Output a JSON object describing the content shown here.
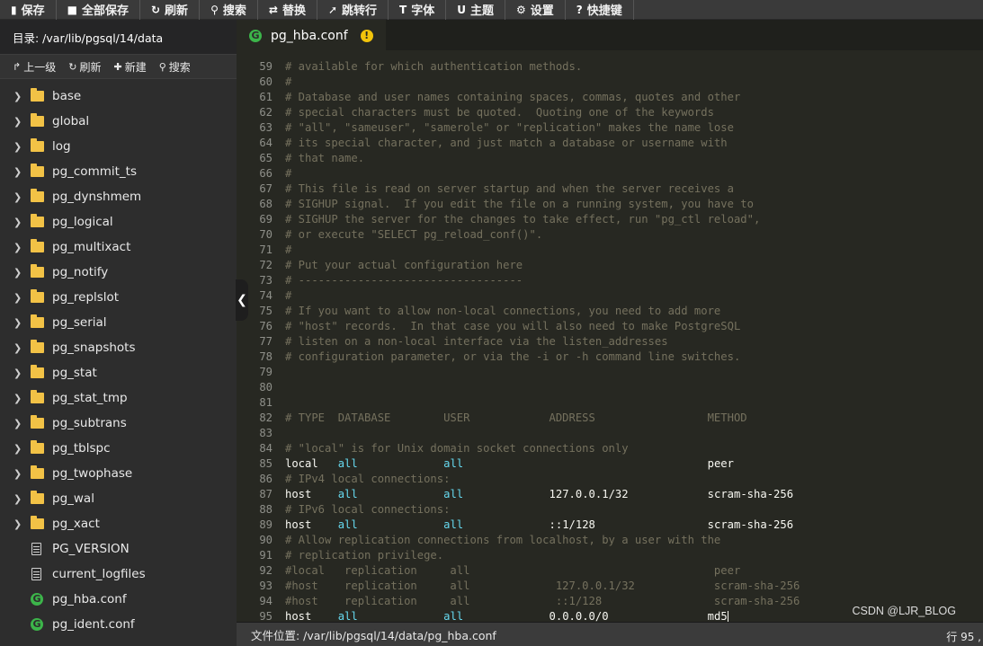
{
  "toolbar": [
    {
      "icon": "save-icon",
      "glyph": "▮",
      "label": "保存"
    },
    {
      "icon": "save-all-icon",
      "glyph": "■",
      "label": "全部保存"
    },
    {
      "icon": "refresh-icon",
      "glyph": "↻",
      "label": "刷新"
    },
    {
      "icon": "search-icon",
      "glyph": "⚲",
      "label": "搜索"
    },
    {
      "icon": "replace-icon",
      "glyph": "⇄",
      "label": "替换"
    },
    {
      "icon": "jump-icon",
      "glyph": "➚",
      "label": "跳转行"
    },
    {
      "icon": "font-icon",
      "glyph": "T",
      "label": "字体"
    },
    {
      "icon": "theme-icon",
      "glyph": "U",
      "label": "主题"
    },
    {
      "icon": "gear-icon",
      "glyph": "⚙",
      "label": "设置"
    },
    {
      "icon": "help-icon",
      "glyph": "?",
      "label": "快捷键"
    }
  ],
  "sidebar": {
    "dir_label": "目录: /var/lib/pgsql/14/data",
    "actions": [
      {
        "icon": "up-icon",
        "glyph": "↱",
        "label": "上一级"
      },
      {
        "icon": "refresh-icon",
        "glyph": "↻",
        "label": "刷新"
      },
      {
        "icon": "plus-icon",
        "glyph": "✚",
        "label": "新建"
      },
      {
        "icon": "search-icon",
        "glyph": "⚲",
        "label": "搜索"
      }
    ],
    "tree": [
      {
        "type": "folder",
        "name": "base"
      },
      {
        "type": "folder",
        "name": "global"
      },
      {
        "type": "folder",
        "name": "log"
      },
      {
        "type": "folder",
        "name": "pg_commit_ts"
      },
      {
        "type": "folder",
        "name": "pg_dynshmem"
      },
      {
        "type": "folder",
        "name": "pg_logical"
      },
      {
        "type": "folder",
        "name": "pg_multixact"
      },
      {
        "type": "folder",
        "name": "pg_notify"
      },
      {
        "type": "folder",
        "name": "pg_replslot"
      },
      {
        "type": "folder",
        "name": "pg_serial"
      },
      {
        "type": "folder",
        "name": "pg_snapshots"
      },
      {
        "type": "folder",
        "name": "pg_stat"
      },
      {
        "type": "folder",
        "name": "pg_stat_tmp"
      },
      {
        "type": "folder",
        "name": "pg_subtrans"
      },
      {
        "type": "folder",
        "name": "pg_tblspc"
      },
      {
        "type": "folder",
        "name": "pg_twophase"
      },
      {
        "type": "folder",
        "name": "pg_wal"
      },
      {
        "type": "folder",
        "name": "pg_xact"
      },
      {
        "type": "file",
        "name": "PG_VERSION"
      },
      {
        "type": "file",
        "name": "current_logfiles"
      },
      {
        "type": "conf",
        "name": "pg_hba.conf"
      },
      {
        "type": "conf",
        "name": "pg_ident.conf"
      }
    ]
  },
  "editor": {
    "tab": {
      "label": "pg_hba.conf",
      "conf_glyph": "G",
      "warn_glyph": "!"
    },
    "lines": [
      {
        "n": "59",
        "kind": "comment",
        "text": "# available for which authentication methods."
      },
      {
        "n": "60",
        "kind": "comment",
        "text": "#"
      },
      {
        "n": "61",
        "kind": "comment",
        "text": "# Database and user names containing spaces, commas, quotes and other"
      },
      {
        "n": "62",
        "kind": "comment",
        "text": "# special characters must be quoted.  Quoting one of the keywords"
      },
      {
        "n": "63",
        "kind": "comment",
        "text": "# \"all\", \"sameuser\", \"samerole\" or \"replication\" makes the name lose"
      },
      {
        "n": "64",
        "kind": "comment",
        "text": "# its special character, and just match a database or username with"
      },
      {
        "n": "65",
        "kind": "comment",
        "text": "# that name."
      },
      {
        "n": "66",
        "kind": "comment",
        "text": "#"
      },
      {
        "n": "67",
        "kind": "comment",
        "text": "# This file is read on server startup and when the server receives a"
      },
      {
        "n": "68",
        "kind": "comment",
        "text": "# SIGHUP signal.  If you edit the file on a running system, you have to"
      },
      {
        "n": "69",
        "kind": "comment",
        "text": "# SIGHUP the server for the changes to take effect, run \"pg_ctl reload\","
      },
      {
        "n": "70",
        "kind": "comment",
        "text": "# or execute \"SELECT pg_reload_conf()\"."
      },
      {
        "n": "71",
        "kind": "comment",
        "text": "#"
      },
      {
        "n": "72",
        "kind": "comment",
        "text": "# Put your actual configuration here"
      },
      {
        "n": "73",
        "kind": "comment",
        "text": "# ----------------------------------"
      },
      {
        "n": "74",
        "kind": "comment",
        "text": "#"
      },
      {
        "n": "75",
        "kind": "comment",
        "text": "# If you want to allow non-local connections, you need to add more"
      },
      {
        "n": "76",
        "kind": "comment",
        "text": "# \"host\" records.  In that case you will also need to make PostgreSQL"
      },
      {
        "n": "77",
        "kind": "comment",
        "text": "# listen on a non-local interface via the listen_addresses"
      },
      {
        "n": "78",
        "kind": "comment",
        "text": "# configuration parameter, or via the -i or -h command line switches."
      },
      {
        "n": "79",
        "kind": "comment",
        "text": ""
      },
      {
        "n": "80",
        "kind": "comment",
        "text": ""
      },
      {
        "n": "81",
        "kind": "comment",
        "text": ""
      },
      {
        "n": "82",
        "kind": "comment",
        "text": "# TYPE  DATABASE        USER            ADDRESS                 METHOD"
      },
      {
        "n": "83",
        "kind": "comment",
        "text": ""
      },
      {
        "n": "84",
        "kind": "comment",
        "text": "# \"local\" is for Unix domain socket connections only"
      },
      {
        "n": "85",
        "kind": "entry",
        "type": "local",
        "db": "all",
        "user": "all",
        "addr": "",
        "method": "peer"
      },
      {
        "n": "86",
        "kind": "comment",
        "text": "# IPv4 local connections:"
      },
      {
        "n": "87",
        "kind": "entry",
        "type": "host",
        "db": "all",
        "user": "all",
        "addr": "127.0.0.1/32",
        "method": "scram-sha-256"
      },
      {
        "n": "88",
        "kind": "comment",
        "text": "# IPv6 local connections:"
      },
      {
        "n": "89",
        "kind": "entry",
        "type": "host",
        "db": "all",
        "user": "all",
        "addr": "::1/128",
        "method": "scram-sha-256"
      },
      {
        "n": "90",
        "kind": "comment",
        "text": "# Allow replication connections from localhost, by a user with the"
      },
      {
        "n": "91",
        "kind": "comment",
        "text": "# replication privilege."
      },
      {
        "n": "92",
        "kind": "comment",
        "text": "#local   replication     all                                     peer"
      },
      {
        "n": "93",
        "kind": "comment",
        "text": "#host    replication     all             127.0.0.1/32            scram-sha-256"
      },
      {
        "n": "94",
        "kind": "comment",
        "text": "#host    replication     all             ::1/128                 scram-sha-256"
      },
      {
        "n": "95",
        "kind": "entry",
        "type": "host",
        "db": "all",
        "user": "all",
        "addr": "0.0.0.0/0",
        "method": "md5",
        "cursor": true
      }
    ]
  },
  "status": {
    "file_location": "文件位置: /var/lib/pgsql/14/data/pg_hba.conf",
    "position": "行 95 ,"
  },
  "watermark": "CSDN @LJR_BLOG"
}
